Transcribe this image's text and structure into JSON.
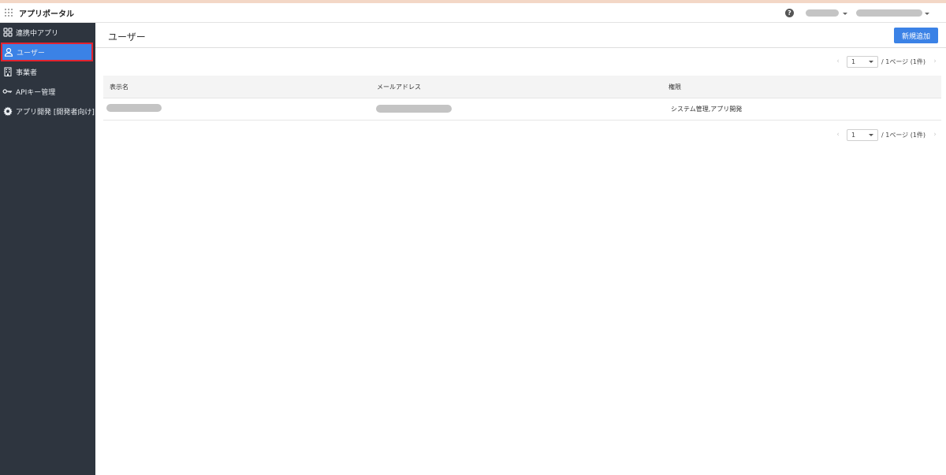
{
  "app": {
    "title": "アプリポータル",
    "help_icon": "?"
  },
  "sidebar": {
    "items": [
      {
        "label": "連携中アプリ",
        "icon": "apps-grid-icon"
      },
      {
        "label": "ユーザー",
        "icon": "user-icon"
      },
      {
        "label": "事業者",
        "icon": "building-icon"
      },
      {
        "label": "APIキー管理",
        "icon": "key-icon"
      },
      {
        "label": "アプリ開発 [開発者向け]",
        "icon": "gear-icon"
      }
    ],
    "active_index": 1
  },
  "page": {
    "title": "ユーザー",
    "new_button": "新規追加"
  },
  "pagination": {
    "prev": "‹",
    "next": "›",
    "current": "1",
    "info": "/ 1ページ (1件)"
  },
  "table": {
    "columns": [
      "表示名",
      "メールアドレス",
      "権限"
    ],
    "rows": [
      {
        "role": "システム管理,アプリ開発"
      }
    ]
  },
  "colors": {
    "sidebar_bg": "#2e353f",
    "accent": "#3b82e6",
    "highlight_border": "#e3232f"
  }
}
